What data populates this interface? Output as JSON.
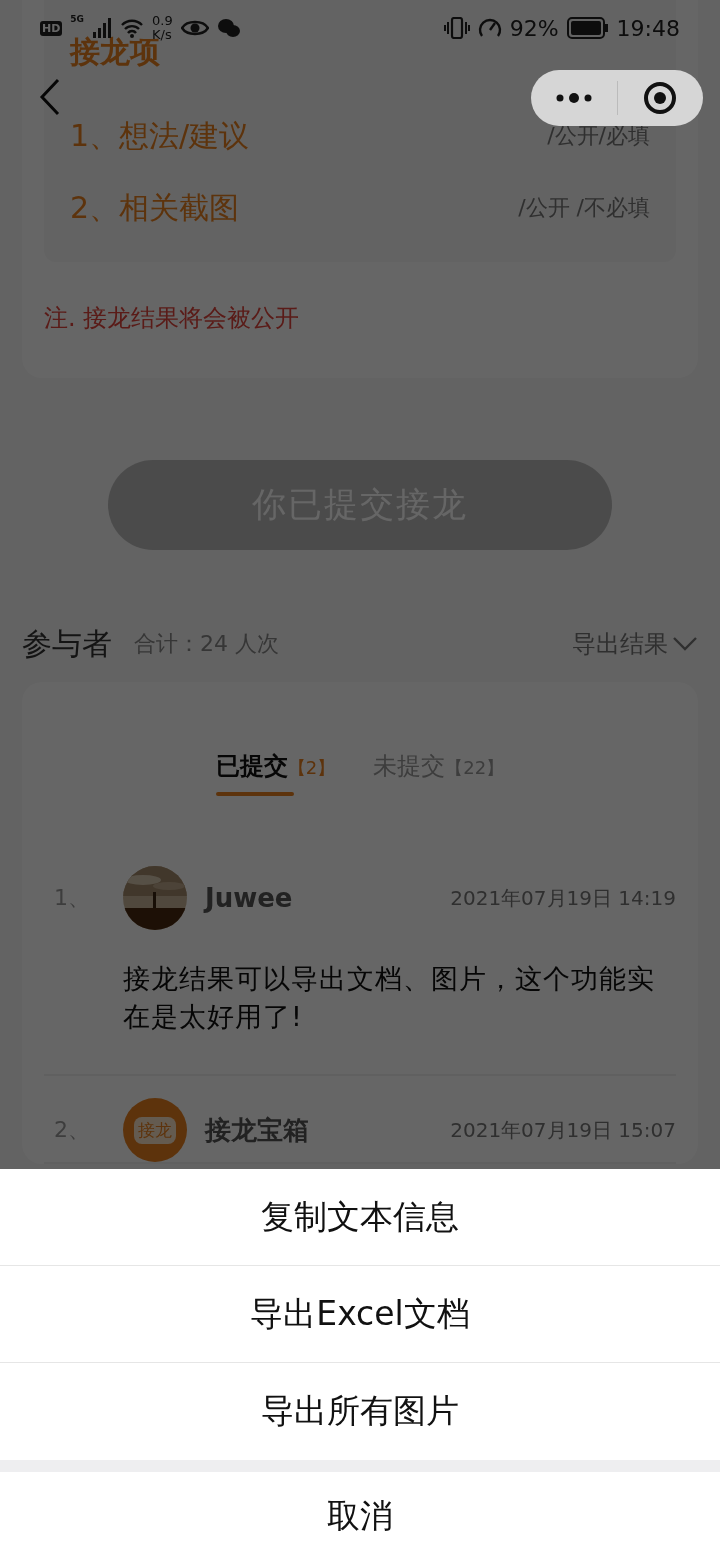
{
  "status_bar": {
    "network_badge": "HD",
    "network_type": "5G",
    "speed_value": "0.9",
    "speed_unit": "K/s",
    "battery": "92%",
    "time": "19:48"
  },
  "form_card": {
    "title": "接龙项",
    "items": [
      {
        "label": "1、想法/建议",
        "tags": "/公开/必填"
      },
      {
        "label": "2、相关截图",
        "tags": "/公开 /不必填"
      }
    ],
    "note": "注. 接龙结果将会被公开"
  },
  "submit_button": {
    "label": "你已提交接龙",
    "disabled": true
  },
  "participants": {
    "title": "参与者",
    "total": "合计：24 人次",
    "export": "导出结果",
    "tabs": [
      {
        "label": "已提交",
        "count": "【2】",
        "selected": true
      },
      {
        "label": "未提交",
        "count": "【22】",
        "selected": false
      }
    ],
    "entries": [
      {
        "index": "1、",
        "name": "Juwee",
        "time": "2021年07月19日 14:19",
        "comment": "接龙结果可以导出文档、图片，这个功能实在是太好用了!"
      },
      {
        "index": "2、",
        "avatar": {
          "kind": "logo",
          "text": "接龙"
        },
        "name": "接龙宝箱",
        "time": "2021年07月19日 15:07"
      }
    ]
  },
  "action_sheet": {
    "options": [
      "复制文本信息",
      "导出Excel文档",
      "导出所有图片"
    ],
    "cancel": "取消"
  }
}
